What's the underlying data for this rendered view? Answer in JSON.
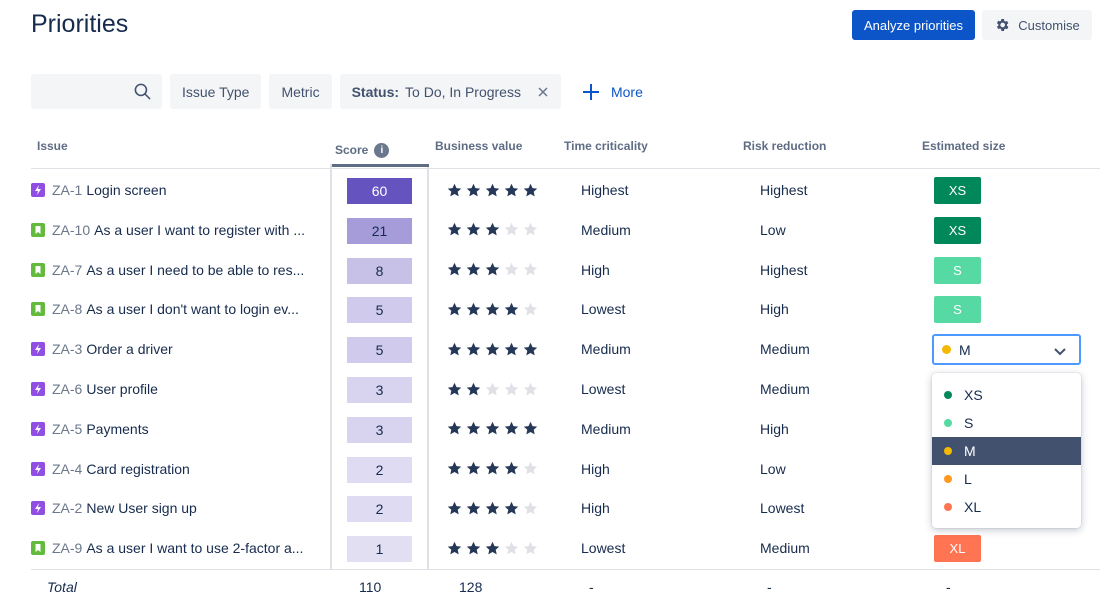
{
  "header": {
    "title": "Priorities",
    "analyze_label": "Analyze priorities",
    "customise_label": "Customise"
  },
  "filters": {
    "search_placeholder": "",
    "issue_type": "Issue Type",
    "metric": "Metric",
    "status_label": "Status:",
    "status_value": "To Do, In Progress",
    "more": "More"
  },
  "columns": {
    "issue": "Issue",
    "score": "Score",
    "business_value": "Business value",
    "time_criticality": "Time criticality",
    "risk_reduction": "Risk reduction",
    "estimated_size": "Estimated size"
  },
  "rows": [
    {
      "key": "ZA-1",
      "title": "Login screen",
      "type": "epic",
      "score": "60",
      "score_level": 1.0,
      "stars": 5,
      "tc": "Highest",
      "rr": "Highest",
      "size": "XS",
      "size_color": "#00875a"
    },
    {
      "key": "ZA-10",
      "title": "As a user I want to register with ...",
      "type": "story",
      "score": "21",
      "score_level": 0.35,
      "stars": 3,
      "tc": "Medium",
      "rr": "Low",
      "size": "XS",
      "size_color": "#00875a"
    },
    {
      "key": "ZA-7",
      "title": "As a user I need to be able to res...",
      "type": "story",
      "score": "8",
      "score_level": 0.13,
      "stars": 3,
      "tc": "High",
      "rr": "Highest",
      "size": "S",
      "size_color": "#57d9a3"
    },
    {
      "key": "ZA-8",
      "title": "As a user I don't want to login ev...",
      "type": "story",
      "score": "5",
      "score_level": 0.08,
      "stars": 4,
      "tc": "Lowest",
      "rr": "High",
      "size": "S",
      "size_color": "#57d9a3"
    },
    {
      "key": "ZA-3",
      "title": "Order a driver",
      "type": "epic",
      "score": "5",
      "score_level": 0.08,
      "stars": 5,
      "tc": "Medium",
      "rr": "Medium",
      "size": "",
      "size_color": ""
    },
    {
      "key": "ZA-6",
      "title": "User profile",
      "type": "epic",
      "score": "3",
      "score_level": 0.05,
      "stars": 2,
      "tc": "Lowest",
      "rr": "Medium",
      "size": "",
      "size_color": ""
    },
    {
      "key": "ZA-5",
      "title": "Payments",
      "type": "epic",
      "score": "3",
      "score_level": 0.05,
      "stars": 5,
      "tc": "Medium",
      "rr": "High",
      "size": "",
      "size_color": ""
    },
    {
      "key": "ZA-4",
      "title": "Card registration",
      "type": "epic",
      "score": "2",
      "score_level": 0.03,
      "stars": 4,
      "tc": "High",
      "rr": "Low",
      "size": "",
      "size_color": ""
    },
    {
      "key": "ZA-2",
      "title": "New User sign up",
      "type": "epic",
      "score": "2",
      "score_level": 0.03,
      "stars": 4,
      "tc": "High",
      "rr": "Lowest",
      "size": "",
      "size_color": ""
    },
    {
      "key": "ZA-9",
      "title": "As a user I want to use 2-factor a...",
      "type": "story",
      "score": "1",
      "score_level": 0.02,
      "stars": 3,
      "tc": "Lowest",
      "rr": "Medium",
      "size": "XL",
      "size_color": "#ff7452"
    }
  ],
  "size_select": {
    "value": "M",
    "dot_color": "#f5b800",
    "options": [
      {
        "label": "XS",
        "color": "#00875a"
      },
      {
        "label": "S",
        "color": "#57d9a3"
      },
      {
        "label": "M",
        "color": "#f5b800"
      },
      {
        "label": "L",
        "color": "#ff991f"
      },
      {
        "label": "XL",
        "color": "#ff7452"
      }
    ]
  },
  "totals": {
    "label": "Total",
    "score": "110",
    "business_value": "128",
    "time_criticality": "-",
    "risk_reduction": "-",
    "estimated_size": "-"
  },
  "colors": {
    "primary": "#0c55c8",
    "epic": "#904ee2",
    "story": "#63ba3c",
    "star_filled": "#253858",
    "star_empty": "#dfe1e6",
    "score_top": "#6554c0"
  }
}
